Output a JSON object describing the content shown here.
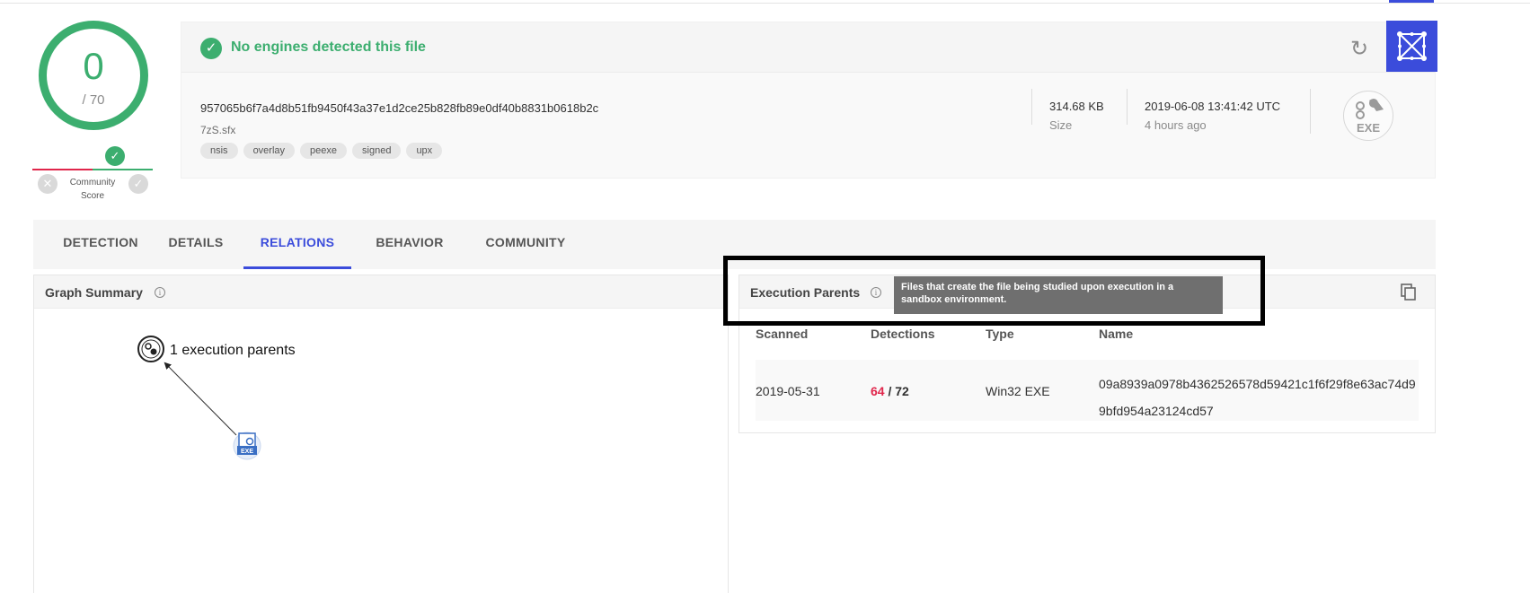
{
  "score": {
    "detections": "0",
    "total": "/ 70"
  },
  "community": {
    "label_line1": "Community",
    "label_line2": "Score"
  },
  "header": {
    "banner_text": "No engines detected this file",
    "hash": "957065b6f7a4d8b51fb9450f43a37e1d2ce25b828fb89e0df40b8831b0618b2c",
    "filename": "7zS.sfx",
    "tags": [
      "nsis",
      "overlay",
      "peexe",
      "signed",
      "upx"
    ],
    "size_value": "314.68 KB",
    "size_label": "Size",
    "date_value": "2019-06-08 13:41:42 UTC",
    "date_label": "4 hours ago",
    "filetype": "EXE"
  },
  "tabs": [
    {
      "label": "DETECTION",
      "active": false
    },
    {
      "label": "DETAILS",
      "active": false
    },
    {
      "label": "RELATIONS",
      "active": true
    },
    {
      "label": "BEHAVIOR",
      "active": false
    },
    {
      "label": "COMMUNITY",
      "active": false
    }
  ],
  "graph": {
    "title": "Graph Summary",
    "node_label": "1 execution parents",
    "file_node_label": "EXE"
  },
  "execution_parents": {
    "title": "Execution Parents",
    "tooltip": "Files that create the file being studied upon execution in a sandbox environment.",
    "columns": [
      "Scanned",
      "Detections",
      "Type",
      "Name"
    ],
    "rows": [
      {
        "scanned": "2019-05-31",
        "detections_positive": "64",
        "detections_total": " / 72",
        "type": "Win32 EXE",
        "name_line1": "09a8939a0978b4362526578d59421c1f6f29f8e63ac74d9",
        "name_line2": "9bfd954a23124cd57"
      }
    ]
  },
  "colors": {
    "accent": "#3b4cdb",
    "clean": "#3cae6f",
    "malicious": "#e0264b"
  }
}
